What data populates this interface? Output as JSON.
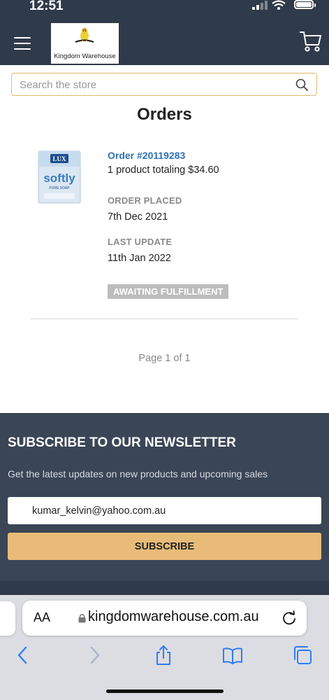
{
  "status_bar": {
    "time": "12:51"
  },
  "header": {
    "logo_text": "Kingdom Warehouse"
  },
  "search": {
    "placeholder": "Search the store"
  },
  "page": {
    "title": "Orders"
  },
  "order": {
    "number": "Order #20119283",
    "summary": "1 product totaling $34.60",
    "placed_label": "ORDER PLACED",
    "placed_date": "7th Dec 2021",
    "update_label": "LAST UPDATE",
    "update_date": "11th Jan 2022",
    "status": "AWAITING FULFILLMENT",
    "product_brand": "LUX",
    "product_name": "softly",
    "product_sub": "PURE SOAP"
  },
  "pagination": {
    "text": "Page 1 of 1"
  },
  "newsletter": {
    "title": "SUBSCRIBE TO OUR NEWSLETTER",
    "description": "Get the latest updates on new products and upcoming sales",
    "email_value": "kumar_kelvin@yahoo.com.au",
    "button_label": "SUBSCRIBE"
  },
  "browser": {
    "aa_label": "AA",
    "url": "kingdomwarehouse.com.au"
  },
  "colors": {
    "header_bg": "#2f3a4a",
    "accent": "#e3b96c",
    "link": "#2f6fb3",
    "newsletter_bg": "#3a4556",
    "button": "#e8bc78"
  },
  "icons": [
    "menu-icon",
    "cart-icon",
    "search-icon",
    "lock-icon",
    "reload-icon",
    "back-icon",
    "forward-icon",
    "share-icon",
    "bookmarks-icon",
    "tabs-icon"
  ]
}
